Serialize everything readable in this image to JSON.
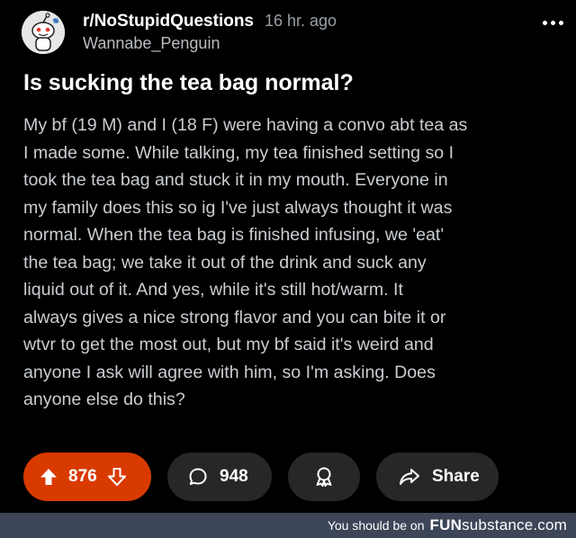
{
  "post": {
    "subreddit": "r/NoStupidQuestions",
    "time_ago": "16 hr. ago",
    "username": "Wannabe_Penguin",
    "title": "Is sucking the tea bag normal?",
    "body_lines": [
      "My bf (19 M) and I (18 F) were having a convo abt tea as",
      "I made some. While talking, my tea finished setting so I",
      "took the tea bag and stuck it in my mouth. Everyone in",
      "my family does this so ig I've just always thought it was",
      "normal. When the tea bag is finished infusing, we 'eat'",
      "the tea bag; we take it out of the drink and suck any",
      "liquid out of it. And yes, while it's still hot/warm. It",
      "always gives a nice strong flavor and you can bite it or",
      "wtvr to get the most out, but my bf said it's weird and",
      "anyone I ask will agree with him, so I'm asking. Does",
      "anyone else do this?"
    ]
  },
  "actions": {
    "upvotes": "876",
    "comments": "948",
    "share_label": "Share"
  },
  "icons": {
    "upvote": "upvote-arrow-icon",
    "downvote": "downvote-arrow-icon",
    "comment": "comment-bubble-icon",
    "award": "award-icon",
    "share": "share-arrow-icon",
    "more": "more-options-icon"
  },
  "colors": {
    "background": "#000000",
    "vote_active": "#d93a00",
    "button_bg": "#272729",
    "footer_bg": "#3d4658"
  },
  "footer": {
    "text": "You should be on",
    "brand_bold": "FUN",
    "brand_rest": "substance.com"
  }
}
